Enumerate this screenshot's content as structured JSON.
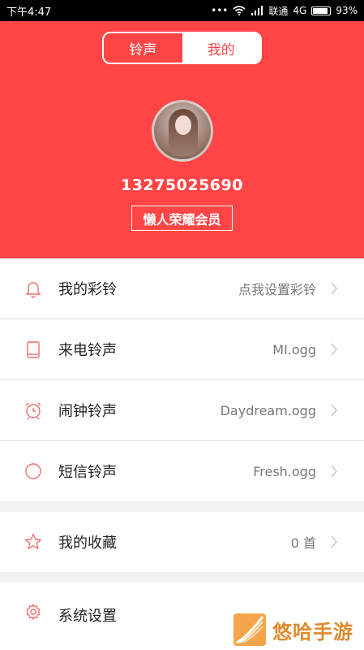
{
  "status_bar": {
    "time": "下午4:47",
    "carrier": "联通",
    "network": "4G",
    "battery": "93%",
    "battery_level": 0.93
  },
  "tabs": [
    {
      "label": "铃声",
      "active": false
    },
    {
      "label": "我的",
      "active": true
    }
  ],
  "profile": {
    "phone": "13275025690",
    "membership": "懒人荣耀会员"
  },
  "settings": [
    {
      "icon": "bell-icon",
      "label": "我的彩铃",
      "value": "点我设置彩铃"
    },
    {
      "icon": "phone-icon",
      "label": "来电铃声",
      "value": "MI.ogg"
    },
    {
      "icon": "alarm-clock-icon",
      "label": "闹钟铃声",
      "value": "Daydream.ogg"
    },
    {
      "icon": "circle-icon",
      "label": "短信铃声",
      "value": "Fresh.ogg"
    },
    {
      "icon": "star-icon",
      "label": "我的收藏",
      "value": "0 首"
    },
    {
      "icon": "gear-icon",
      "label": "系统设置",
      "value": ""
    }
  ],
  "watermark": {
    "text": "悠哈手游"
  },
  "colors": {
    "accent": "#ff4545",
    "icon": "#f06b6b"
  }
}
